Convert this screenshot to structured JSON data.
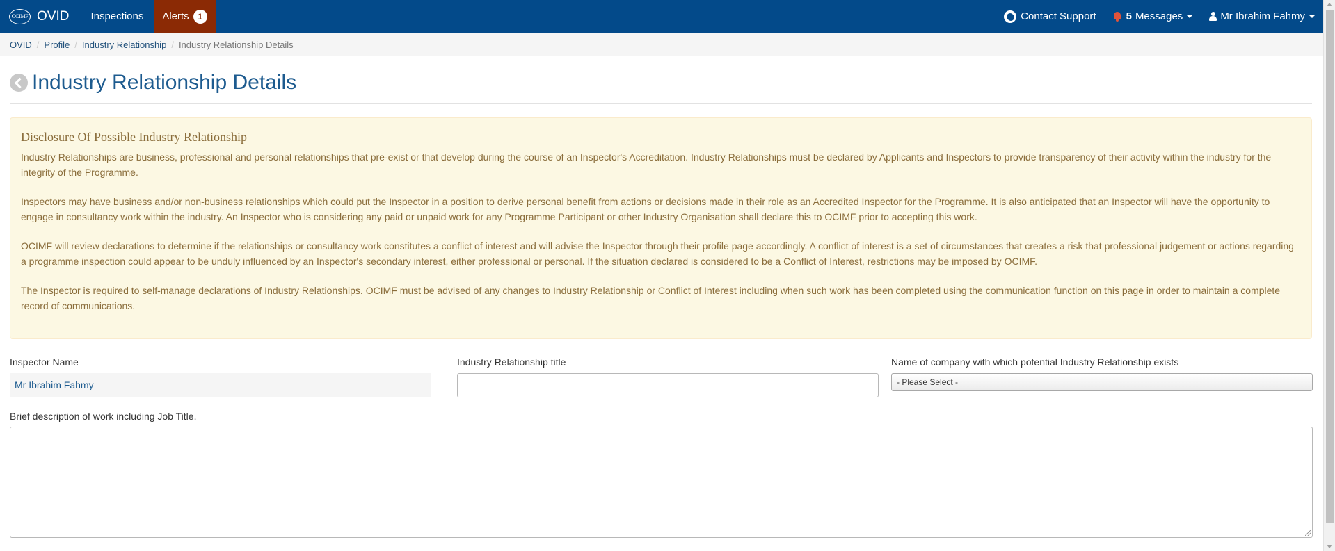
{
  "navbar": {
    "brand_logo_text": "OCIMF",
    "brand_text": "OVID",
    "links": [
      {
        "label": "Inspections"
      },
      {
        "label": "Alerts",
        "badge": "1"
      }
    ],
    "contact_support": "Contact Support",
    "messages_count": "5",
    "messages_label": "Messages",
    "user_name": "Mr Ibrahim Fahmy",
    "colors": {
      "bar": "#034a8a",
      "alerts": "#8b2a05",
      "bell": "#e0533a"
    }
  },
  "breadcrumb": {
    "items": [
      "OVID",
      "Profile",
      "Industry Relationship"
    ],
    "active": "Industry Relationship Details"
  },
  "page": {
    "title": "Industry Relationship Details"
  },
  "disclosure": {
    "title": "Disclosure Of Possible Industry Relationship",
    "paragraphs": [
      "Industry Relationships are business, professional and personal relationships that pre-exist or that develop during the course of an Inspector's Accreditation. Industry Relationships must be declared by Applicants and Inspectors to provide transparency of their activity within the industry for the integrity of the Programme.",
      "Inspectors may have business and/or non-business relationships which could put the Inspector in a position to derive personal benefit from actions or decisions made in their role as an Accredited Inspector for the Programme. It is also anticipated that an Inspector will have the opportunity to engage in consultancy work within the industry. An Inspector who is considering any paid or unpaid work for any Programme Participant or other Industry Organisation shall declare this to OCIMF prior to accepting this work.",
      "OCIMF will review declarations to determine if the relationships or consultancy work constitutes a conflict of interest and will advise the Inspector through their profile page accordingly. A conflict of interest is a set of circumstances that creates a risk that professional judgement or actions regarding a programme inspection could appear to be unduly influenced by an Inspector's secondary interest, either professional or personal. If the situation declared is considered to be a Conflict of Interest, restrictions may be imposed by OCIMF.",
      "The Inspector is required to self-manage declarations of Industry Relationships. OCIMF must be advised of any changes to Industry Relationship or Conflict of Interest including when such work has been completed using the communication function on this page in order to maintain a complete record of communications."
    ]
  },
  "form": {
    "inspector_name_label": "Inspector Name",
    "inspector_name_value": "Mr Ibrahim Fahmy",
    "relationship_title_label": "Industry Relationship title",
    "relationship_title_value": "",
    "company_label": "Name of company with which potential Industry Relationship exists",
    "company_selected": "- Please Select -",
    "description_label": "Brief description of work including Job Title.",
    "description_value": ""
  }
}
